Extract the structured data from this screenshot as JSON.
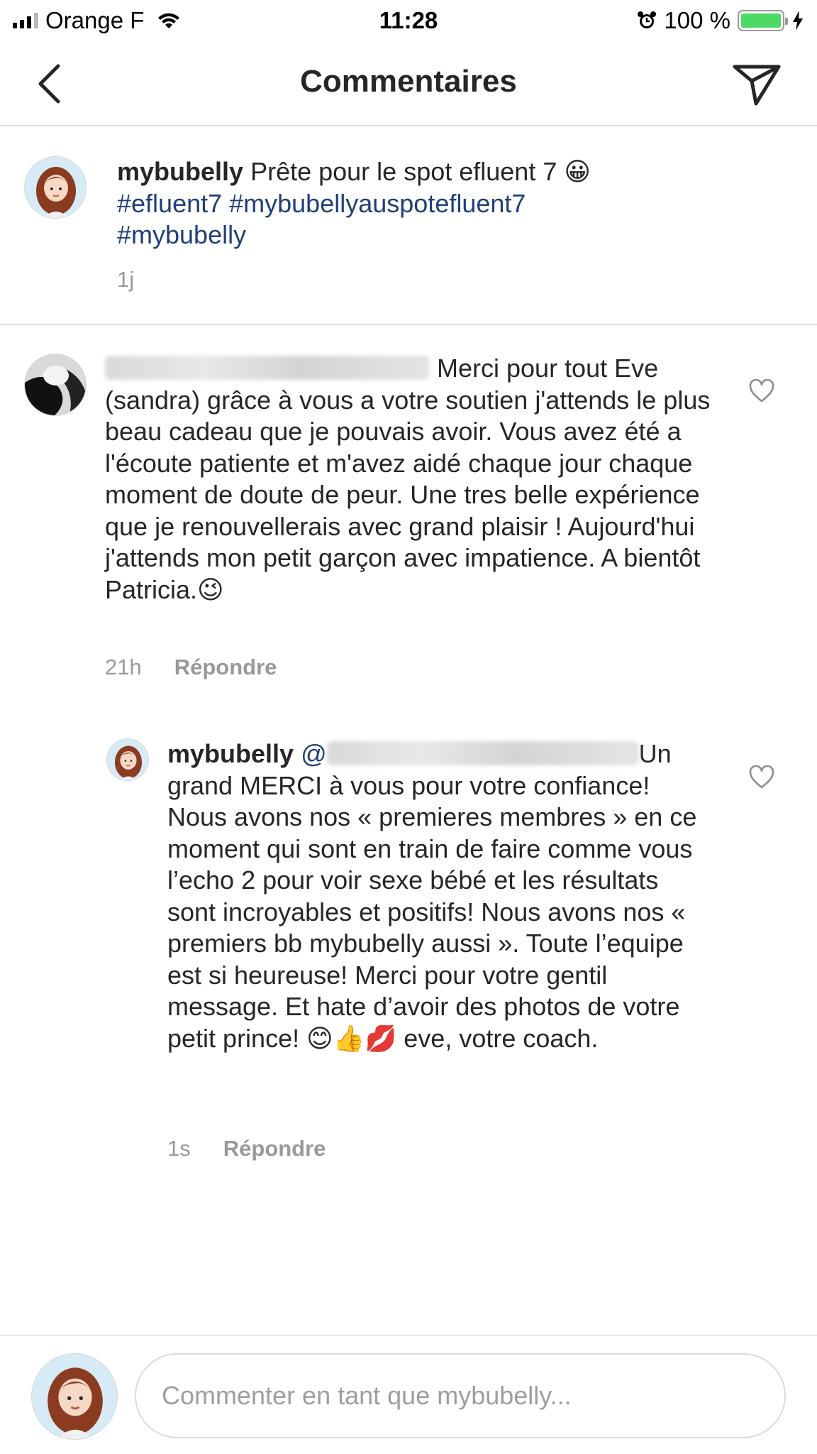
{
  "status_bar": {
    "carrier": "Orange F",
    "time": "11:28",
    "battery": "100 %",
    "icons": [
      "signal-icon",
      "wifi-icon",
      "alarm-icon",
      "battery-icon",
      "charging-icon"
    ]
  },
  "header": {
    "title": "Commentaires",
    "back_icon": "chevron-left-icon",
    "send_icon": "send-icon"
  },
  "caption": {
    "username": "mybubelly",
    "text": " Prête pour le spot efluent 7 😀",
    "hashtags_line1": "#efluent7 #mybubellyauspotefluent7",
    "hashtags_line2": "#mybubelly",
    "time": "1j"
  },
  "comments": [
    {
      "username": "babychoudamour2018",
      "text": " Merci pour tout Eve (sandra) grâce à vous a votre soutien j'attends le plus beau cadeau que je pouvais avoir. Vous avez été a l'écoute patiente et m'avez aidé chaque jour chaque moment de doute de peur. Une tres belle expérience que je renouvellerais avec grand plaisir ! Aujourd'hui j'attends mon petit garçon avec impatience. A bientôt Patricia.😉",
      "time": "21h",
      "reply_label": "Répondre"
    },
    {
      "username": "mybubelly",
      "mention": "@",
      "mention_user": "babychoudamour2018",
      "text": "Un grand MERCI à vous pour votre confiance! Nous avons nos «  premieres membres » en ce moment qui sont en train de faire comme vous l’echo 2 pour voir sexe bébé et les résultats sont incroyables et positifs! Nous avons nos «  premiers bb mybubelly aussi ». Toute l’equipe est si heureuse! Merci pour votre gentil message. Et hate d’avoir des photos de votre petit prince! 😊👍💋 eve, votre coach.",
      "time": "1s",
      "reply_label": "Répondre"
    }
  ],
  "comment_bar": {
    "placeholder": "Commenter en tant que mybubelly..."
  },
  "colors": {
    "hashtag": "#1f3f7a",
    "muted": "#999999",
    "divider": "#dbdbdb",
    "battery": "#4cd964"
  }
}
